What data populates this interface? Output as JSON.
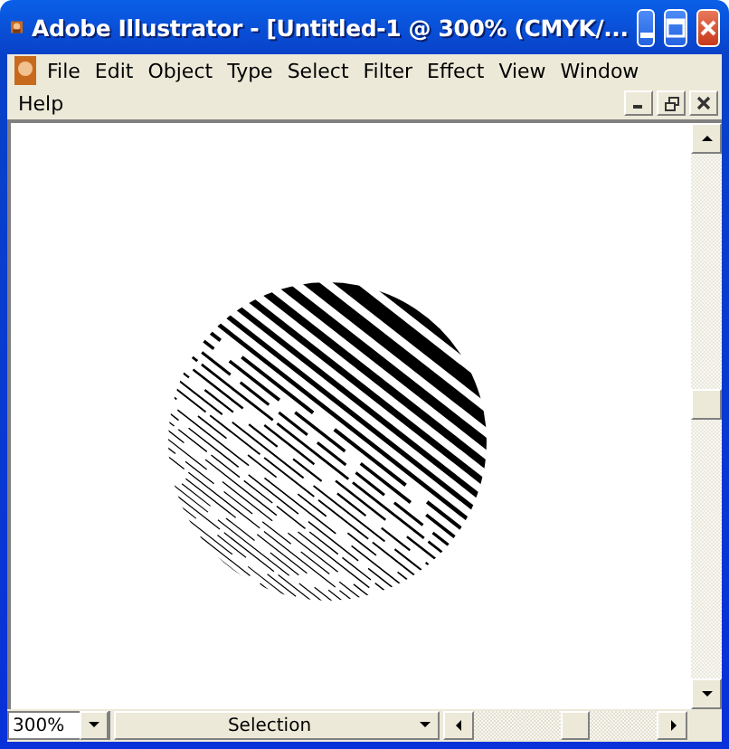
{
  "window": {
    "title": "Adobe Illustrator - [Untitled-1 @ 300% (CMYK/..."
  },
  "menu": [
    "File",
    "Edit",
    "Object",
    "Type",
    "Select",
    "Filter",
    "Effect",
    "View",
    "Window",
    "Help"
  ],
  "status_bar": {
    "zoom": "300%",
    "tool": "Selection"
  }
}
